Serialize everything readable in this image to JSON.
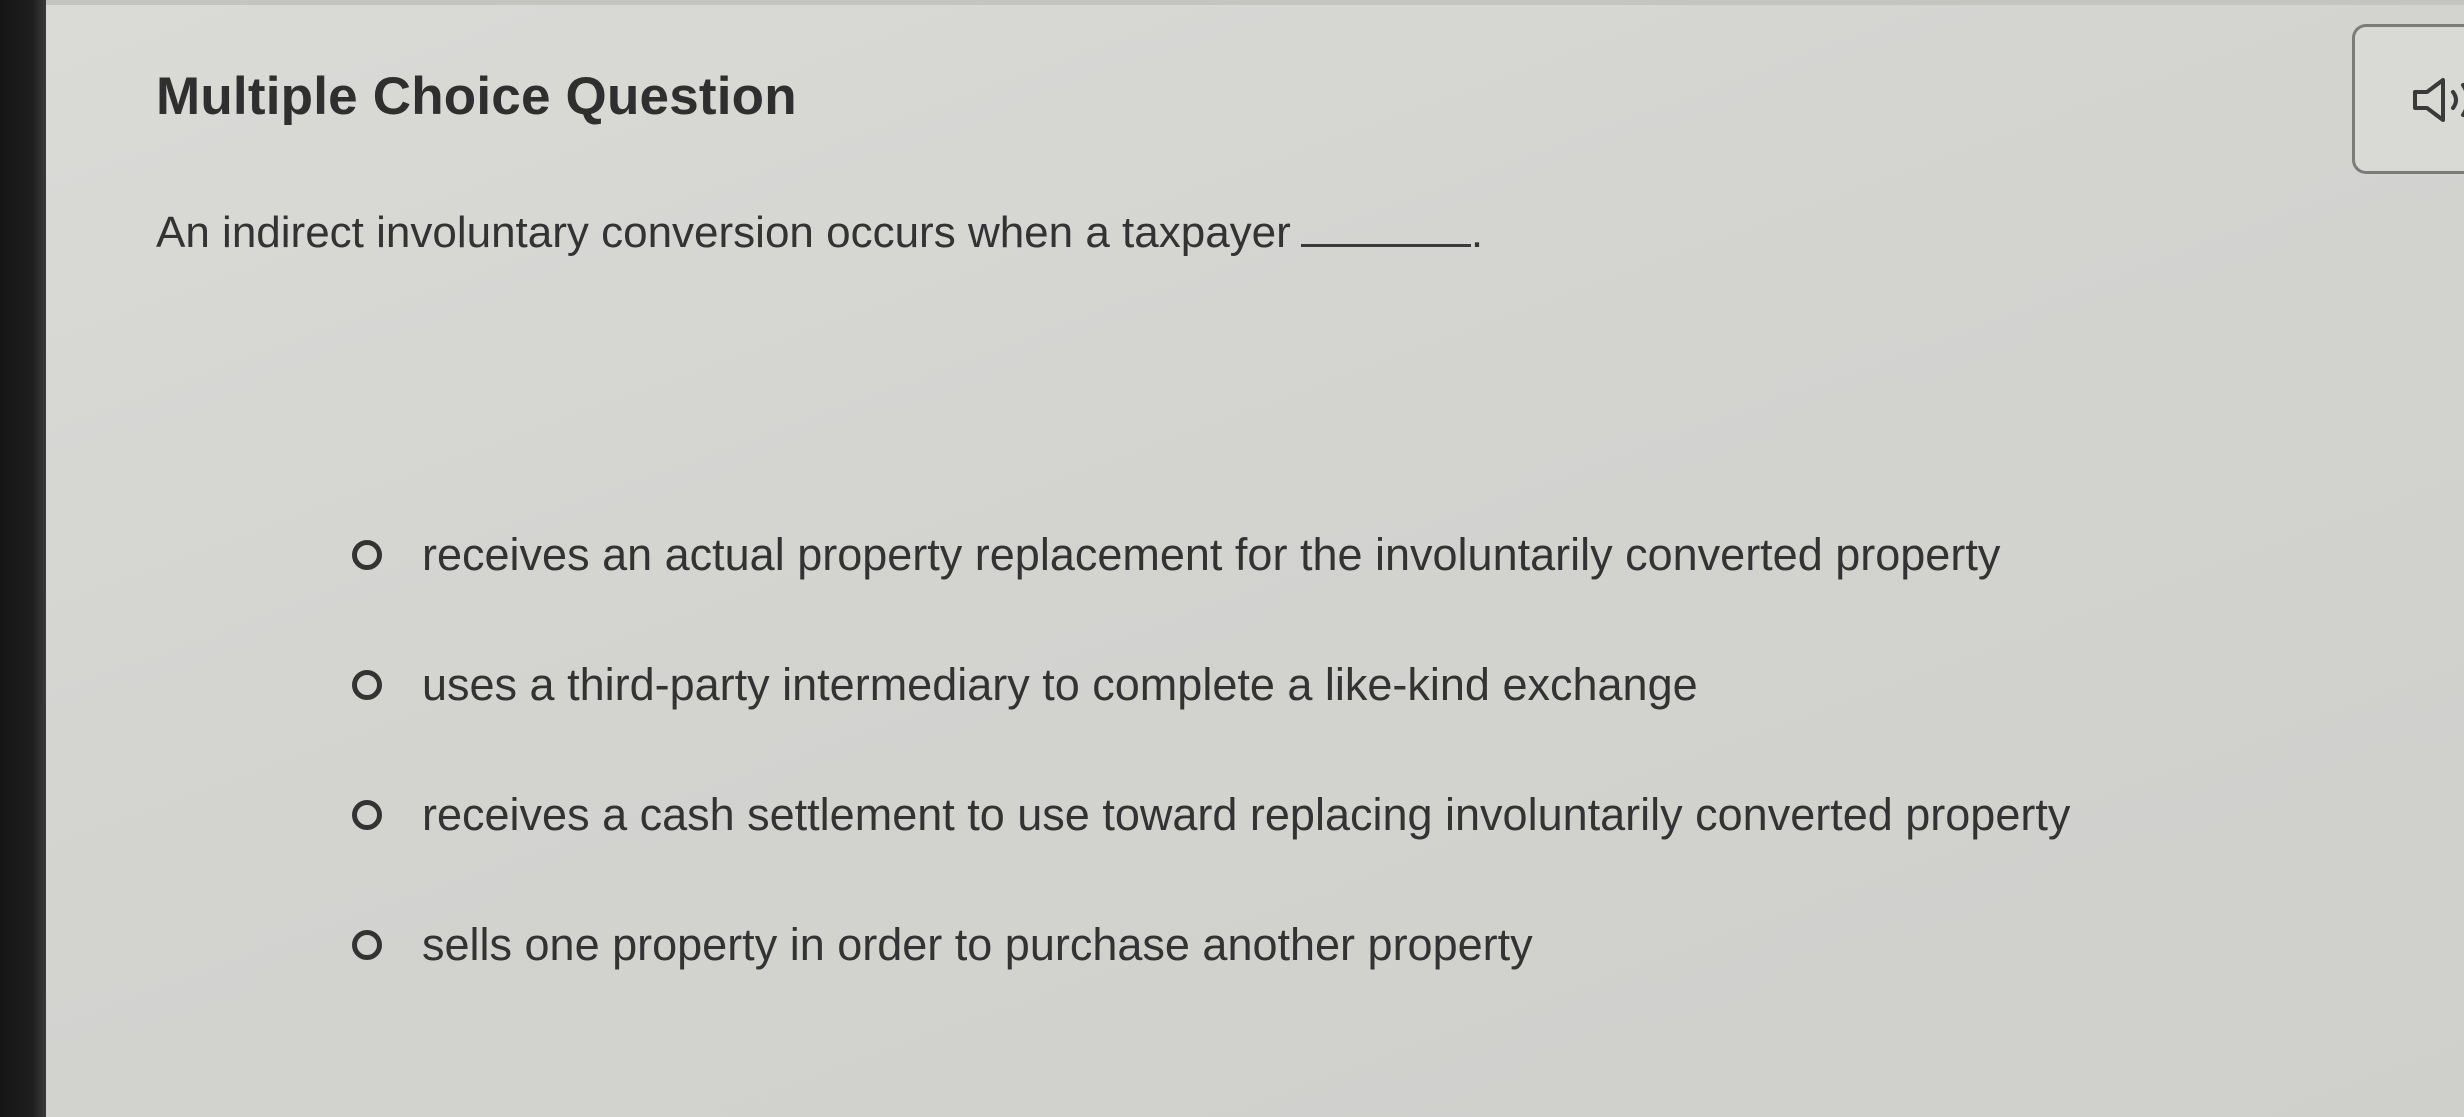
{
  "question": {
    "heading": "Multiple Choice Question",
    "prompt": "An indirect involuntary conversion occurs when a taxpayer",
    "prompt_end": ".",
    "audio_icon": "speaker-icon"
  },
  "options": [
    {
      "label": "receives an actual property replacement for the involuntarily converted property",
      "selected": false
    },
    {
      "label": "uses a third-party intermediary to complete a like-kind exchange",
      "selected": false
    },
    {
      "label": "receives a cash settlement to use toward replacing involuntarily converted property",
      "selected": false
    },
    {
      "label": "sells one property in order to purchase another property",
      "selected": false
    }
  ],
  "colors": {
    "background": "#d4d4d2",
    "text": "#333333",
    "bezel": "#1a1a1a"
  }
}
